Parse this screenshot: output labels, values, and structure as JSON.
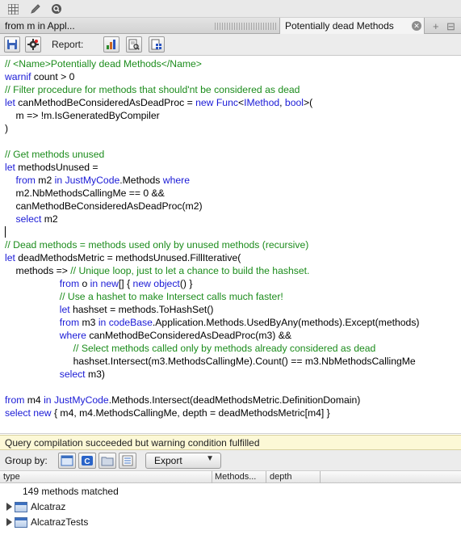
{
  "topbar": {
    "icons": [
      "grid-icon",
      "pencil-icon",
      "magnifier-icon"
    ]
  },
  "tabs": {
    "left_label": "from m in Appl...",
    "active_label": "Potentially dead Methods"
  },
  "toolbar": {
    "report_label": "Report:"
  },
  "editor": {
    "lines": [
      [
        [
          "cm",
          "// <Name>Potentially dead Methods</Name>"
        ]
      ],
      [
        [
          "kw",
          "warnif"
        ],
        [
          "tx",
          " count > 0"
        ]
      ],
      [
        [
          "cm",
          "// Filter procedure for methods that should'nt be considered as dead"
        ]
      ],
      [
        [
          "kw",
          "let"
        ],
        [
          "tx",
          " canMethodBeConsideredAsDeadProc = "
        ],
        [
          "kw",
          "new"
        ],
        [
          "tx",
          " "
        ],
        [
          "ty",
          "Func"
        ],
        [
          "tx",
          "<"
        ],
        [
          "ty",
          "IMethod"
        ],
        [
          "tx",
          ", "
        ],
        [
          "kw",
          "bool"
        ],
        [
          "tx",
          ">("
        ]
      ],
      [
        [
          "tx",
          "    m => !m.IsGeneratedByCompiler"
        ]
      ],
      [
        [
          "tx",
          ")"
        ]
      ],
      [
        [
          "tx",
          ""
        ]
      ],
      [
        [
          "cm",
          "// Get methods unused"
        ]
      ],
      [
        [
          "kw",
          "let"
        ],
        [
          "tx",
          " methodsUnused ="
        ]
      ],
      [
        [
          "tx",
          "    "
        ],
        [
          "kw",
          "from"
        ],
        [
          "tx",
          " m2 "
        ],
        [
          "kw",
          "in"
        ],
        [
          "tx",
          " "
        ],
        [
          "ty",
          "JustMyCode"
        ],
        [
          "tx",
          ".Methods "
        ],
        [
          "kw",
          "where"
        ]
      ],
      [
        [
          "tx",
          "    m2.NbMethodsCallingMe == 0 &&"
        ]
      ],
      [
        [
          "tx",
          "    canMethodBeConsideredAsDeadProc(m2)"
        ]
      ],
      [
        [
          "tx",
          "    "
        ],
        [
          "kw",
          "select"
        ],
        [
          "tx",
          " m2"
        ]
      ],
      [
        [
          "tx",
          ""
        ]
      ],
      [
        [
          "cm",
          "// Dead methods = methods used only by unused methods (recursive)"
        ]
      ],
      [
        [
          "kw",
          "let"
        ],
        [
          "tx",
          " deadMethodsMetric = methodsUnused.FillIterative("
        ]
      ],
      [
        [
          "tx",
          "    methods => "
        ],
        [
          "cm",
          "// Unique loop, just to let a chance to build the hashset."
        ]
      ],
      [
        [
          "tx",
          "                    "
        ],
        [
          "kw",
          "from"
        ],
        [
          "tx",
          " o "
        ],
        [
          "kw",
          "in"
        ],
        [
          "tx",
          " "
        ],
        [
          "kw",
          "new"
        ],
        [
          "tx",
          "[] { "
        ],
        [
          "kw",
          "new"
        ],
        [
          "tx",
          " "
        ],
        [
          "kw",
          "object"
        ],
        [
          "tx",
          "() }"
        ]
      ],
      [
        [
          "tx",
          "                    "
        ],
        [
          "cm",
          "// Use a hashet to make Intersect calls much faster!"
        ]
      ],
      [
        [
          "tx",
          "                    "
        ],
        [
          "kw",
          "let"
        ],
        [
          "tx",
          " hashset = methods.ToHashSet()"
        ]
      ],
      [
        [
          "tx",
          "                    "
        ],
        [
          "kw",
          "from"
        ],
        [
          "tx",
          " m3 "
        ],
        [
          "kw",
          "in"
        ],
        [
          "tx",
          " "
        ],
        [
          "ty",
          "codeBase"
        ],
        [
          "tx",
          ".Application.Methods.UsedByAny(methods).Except(methods)"
        ]
      ],
      [
        [
          "tx",
          "                    "
        ],
        [
          "kw",
          "where"
        ],
        [
          "tx",
          " canMethodBeConsideredAsDeadProc(m3) &&"
        ]
      ],
      [
        [
          "tx",
          "                         "
        ],
        [
          "cm",
          "// Select methods called only by methods already considered as dead"
        ]
      ],
      [
        [
          "tx",
          "                         hashset.Intersect(m3.MethodsCallingMe).Count() == m3.NbMethodsCallingMe"
        ]
      ],
      [
        [
          "tx",
          "                    "
        ],
        [
          "kw",
          "select"
        ],
        [
          "tx",
          " m3)"
        ]
      ],
      [
        [
          "tx",
          ""
        ]
      ],
      [
        [
          "kw",
          "from"
        ],
        [
          "tx",
          " m4 "
        ],
        [
          "kw",
          "in"
        ],
        [
          "tx",
          " "
        ],
        [
          "ty",
          "JustMyCode"
        ],
        [
          "tx",
          ".Methods.Intersect(deadMethodsMetric.DefinitionDomain)"
        ]
      ],
      [
        [
          "kw",
          "select"
        ],
        [
          "tx",
          " "
        ],
        [
          "kw",
          "new"
        ],
        [
          "tx",
          " { m4, m4.MethodsCallingMe, depth = deadMethodsMetric[m4] }"
        ]
      ]
    ]
  },
  "status": {
    "message": "Query compilation succeeded but warning condition fulfilled"
  },
  "groupbar": {
    "label": "Group by:",
    "export_label": "Export"
  },
  "grid": {
    "columns": [
      "type",
      "Methods...",
      "depth"
    ],
    "matched_text": "149 methods matched",
    "rows": [
      "Alcatraz",
      "AlcatrazTests"
    ]
  },
  "colors": {
    "comment": "#1c8c1c",
    "keyword": "#1a1ad6",
    "status_bg": "#fcf8d6"
  }
}
